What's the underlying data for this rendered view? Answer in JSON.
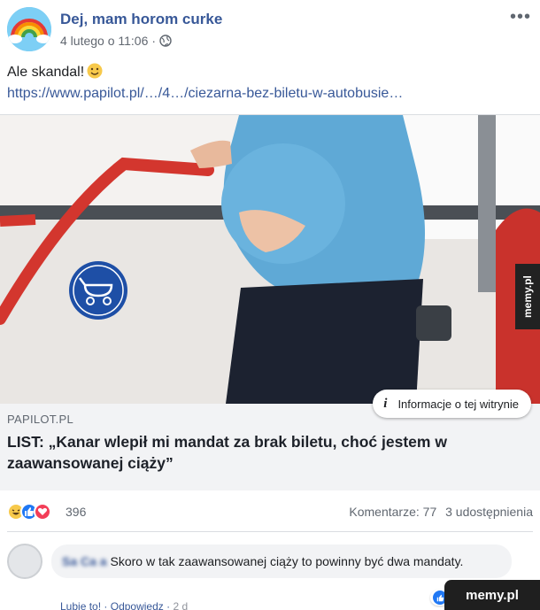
{
  "post": {
    "page_name": "Dej, mam horom curke",
    "timestamp": "4 lutego o 11:06",
    "separator": "·",
    "text": "Ale skandal!",
    "link": "https://www.papilot.pl/…/4…/ciezarna-bez-biletu-w-autobusie…"
  },
  "preview": {
    "domain": "PAPILOT.PL",
    "title": "LIST: „Kanar wlepił mi mandat za brak biletu, choć jestem w zaawansowanej ciąży”",
    "info_label": "Informacje o tej witrynie"
  },
  "stats": {
    "reactions": "396",
    "comments": "Komentarze: 77",
    "shares": "3 udostępnienia"
  },
  "comment": {
    "author": "Sa   Ca  a",
    "text": "Skoro w tak zaawansowanej ciąży to powinny być dwa mandaty.",
    "like": "Lubię to!",
    "reply": "Odpowiedz",
    "time": "2 d"
  },
  "watermark": {
    "side": "memy.pl",
    "corner": "memy.pl"
  },
  "colors": {
    "link": "#385898",
    "like_blue": "#2078f4",
    "love_red": "#f33e58",
    "haha_yellow": "#f7c94b"
  },
  "icons": [
    "rainbow-avatar-icon",
    "globe-icon",
    "more-dots-icon",
    "smile-emoji-icon",
    "info-icon",
    "haha-icon",
    "like-icon",
    "love-icon"
  ]
}
